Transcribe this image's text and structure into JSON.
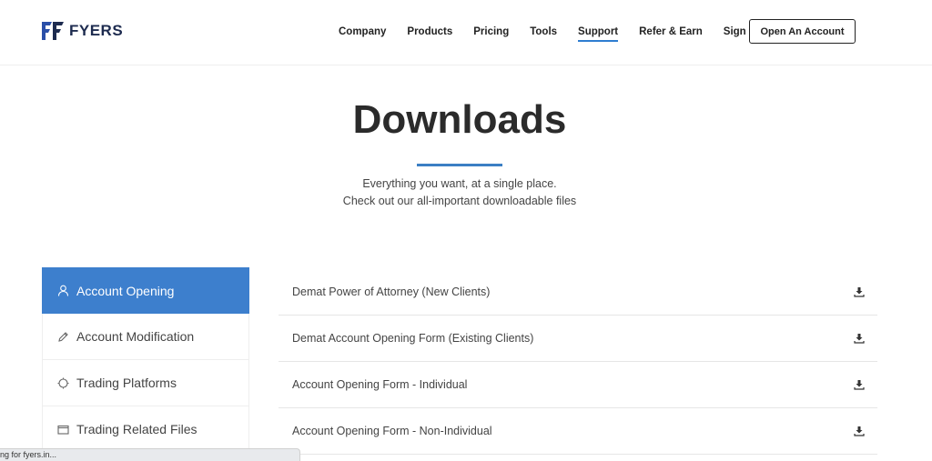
{
  "header": {
    "logo_text": "FYERS",
    "nav": [
      {
        "label": "Company"
      },
      {
        "label": "Products"
      },
      {
        "label": "Pricing"
      },
      {
        "label": "Tools"
      },
      {
        "label": "Support",
        "active": true
      },
      {
        "label": "Refer & Earn"
      },
      {
        "label": "Sign In"
      }
    ],
    "cta_label": "Open An Account"
  },
  "hero": {
    "title": "Downloads",
    "subtitle_line1": "Everything you want, at a single place.",
    "subtitle_line2": "Check out our all-important downloadable files"
  },
  "sidebar": {
    "items": [
      {
        "label": "Account Opening",
        "icon": "user-icon",
        "active": true
      },
      {
        "label": "Account Modification",
        "icon": "pencil-icon"
      },
      {
        "label": "Trading Platforms",
        "icon": "target-icon"
      },
      {
        "label": "Trading Related Files",
        "icon": "folder-icon"
      }
    ]
  },
  "downloads": {
    "items": [
      {
        "label": "Demat Power of Attorney (New Clients)",
        "icon": "download-icon"
      },
      {
        "label": "Demat Account Opening Form (Existing Clients)",
        "icon": "download-icon"
      },
      {
        "label": "Account Opening Form - Individual",
        "icon": "download-icon"
      },
      {
        "label": "Account Opening Form - Non-Individual",
        "icon": "download-icon"
      }
    ]
  },
  "status_bar": {
    "text": "ng for fyers.in..."
  },
  "colors": {
    "accent": "#3d7fcd",
    "underline": "#3b7fc4",
    "logo": "#1d2b4f"
  }
}
